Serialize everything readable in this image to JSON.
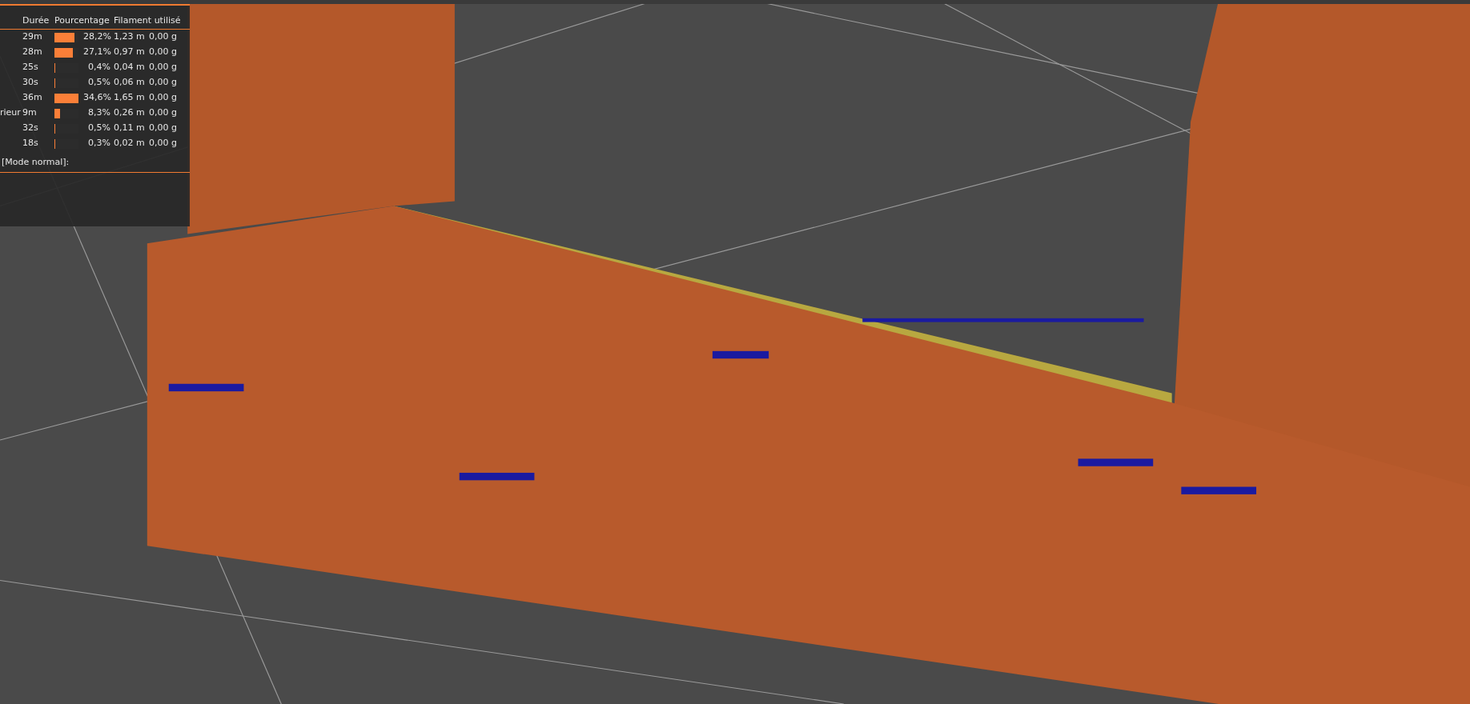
{
  "legend": {
    "columns": [
      {
        "label": "Durée"
      },
      {
        "label": "Pourcentage"
      },
      {
        "label": "Filament utilisé"
      }
    ],
    "rows": [
      {
        "duration": "29m",
        "level": 0.82,
        "percent": "28,2%",
        "length": "1,23 m",
        "weight": "0,00 g"
      },
      {
        "duration": "28m",
        "level": 0.78,
        "percent": "27,1%",
        "length": "0,97 m",
        "weight": "0,00 g"
      },
      {
        "duration": "25s",
        "level": 0.01,
        "percent": "0,4%",
        "length": "0,04 m",
        "weight": "0,00 g"
      },
      {
        "duration": "30s",
        "level": 0.01,
        "percent": "0,5%",
        "length": "0,06 m",
        "weight": "0,00 g"
      },
      {
        "duration": "36m",
        "level": 1.0,
        "percent": "34,6%",
        "length": "1,65 m",
        "weight": "0,00 g"
      },
      {
        "label": "rieur",
        "duration": "9m",
        "level": 0.24,
        "percent": "8,3%",
        "length": "0,26 m",
        "weight": "0,00 g"
      },
      {
        "duration": "32s",
        "level": 0.01,
        "percent": "0,5%",
        "length": "0,11 m",
        "weight": "0,00 g"
      },
      {
        "duration": "18s",
        "level": 0.01,
        "percent": "0,3%",
        "length": "0,02 m",
        "weight": "0,00 g"
      }
    ],
    "section_title": "[Mode normal]:"
  }
}
